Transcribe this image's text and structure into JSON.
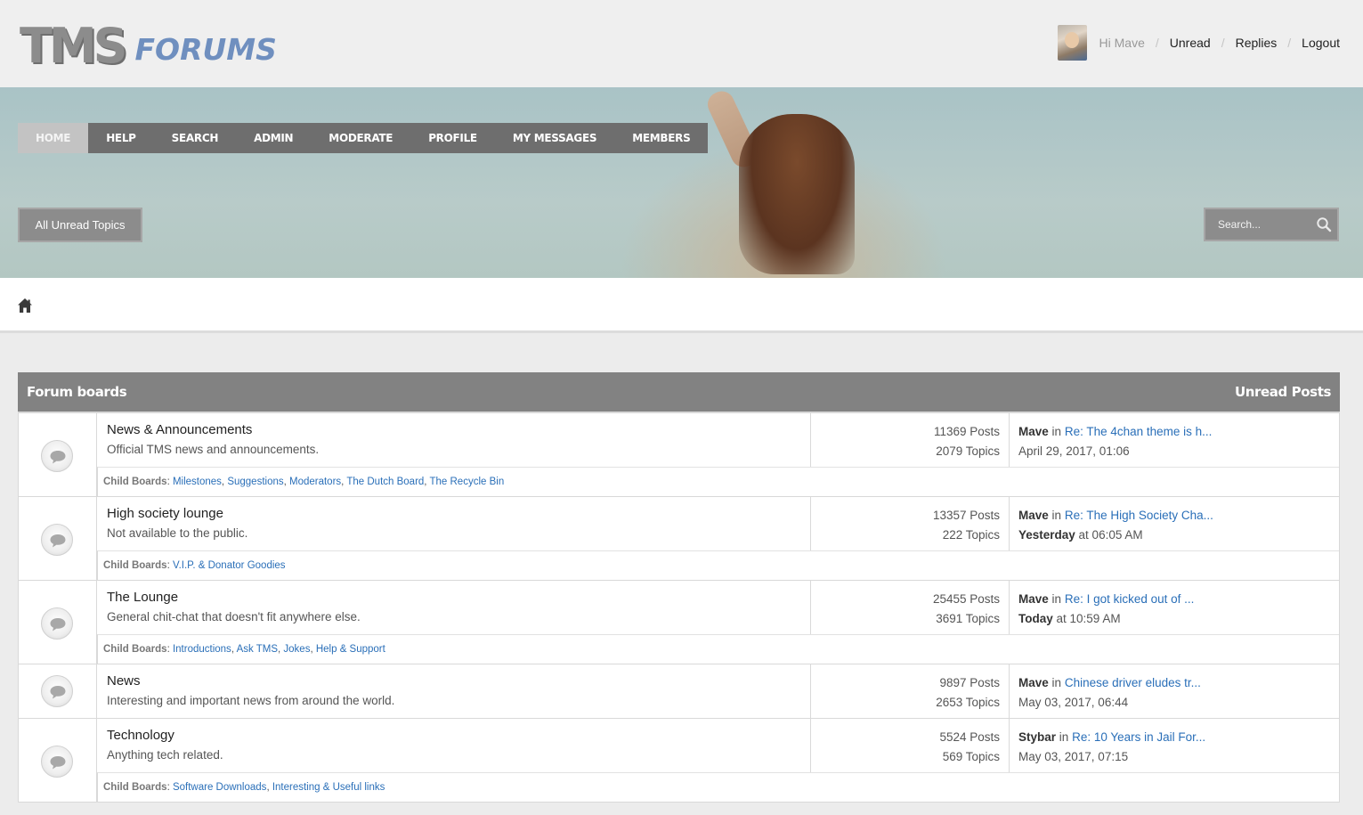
{
  "header": {
    "logo_tms": "TMS",
    "logo_forums": "FORUMS",
    "greeting": "Hi Mave",
    "links": [
      "Unread",
      "Replies",
      "Logout"
    ]
  },
  "nav": {
    "items": [
      "HOME",
      "HELP",
      "SEARCH",
      "ADMIN",
      "MODERATE",
      "PROFILE",
      "MY MESSAGES",
      "MEMBERS"
    ],
    "active": "HOME"
  },
  "banner": {
    "unread_button": "All Unread Topics",
    "search_placeholder": "Search..."
  },
  "boards": {
    "header_left": "Forum boards",
    "header_right": "Unread Posts",
    "child_label": "Child Boards",
    "list": [
      {
        "name": "News & Announcements",
        "desc": "Official TMS news and announcements.",
        "posts": "11369 Posts",
        "topics": "2079 Topics",
        "last_user": "Mave",
        "last_in": "in",
        "last_topic": "Re: The 4chan theme is h...",
        "last_date": "April 29, 2017, 01:06",
        "last_date_bold": "",
        "children": [
          "Milestones",
          "Suggestions",
          "Moderators",
          "The Dutch Board",
          "The Recycle Bin"
        ]
      },
      {
        "name": "High society lounge",
        "desc": "Not available to the public.",
        "posts": "13357 Posts",
        "topics": "222 Topics",
        "last_user": "Mave",
        "last_in": "in",
        "last_topic": "Re: The High Society Cha...",
        "last_date_bold": "Yesterday",
        "last_date": "at 06:05 AM",
        "children": [
          "V.I.P. & Donator Goodies"
        ]
      },
      {
        "name": "The Lounge",
        "desc": "General chit-chat that doesn't fit anywhere else.",
        "posts": "25455 Posts",
        "topics": "3691 Topics",
        "last_user": "Mave",
        "last_in": "in",
        "last_topic": "Re: I got kicked out of ...",
        "last_date_bold": "Today",
        "last_date": "at 10:59 AM",
        "children": [
          "Introductions",
          "Ask TMS",
          "Jokes",
          "Help & Support"
        ]
      },
      {
        "name": "News",
        "desc": "Interesting and important news from around the world.",
        "posts": "9897 Posts",
        "topics": "2653 Topics",
        "last_user": "Mave",
        "last_in": "in",
        "last_topic": "Chinese driver eludes tr...",
        "last_date_bold": "",
        "last_date": "May 03, 2017, 06:44",
        "children": []
      },
      {
        "name": "Technology",
        "desc": "Anything tech related.",
        "posts": "5524 Posts",
        "topics": "569 Topics",
        "last_user": "Stybar",
        "last_in": "in",
        "last_topic": "Re: 10 Years in Jail For...",
        "last_date_bold": "",
        "last_date": "May 03, 2017, 07:15",
        "children": [
          "Software Downloads",
          "Interesting & Useful links"
        ]
      }
    ]
  }
}
